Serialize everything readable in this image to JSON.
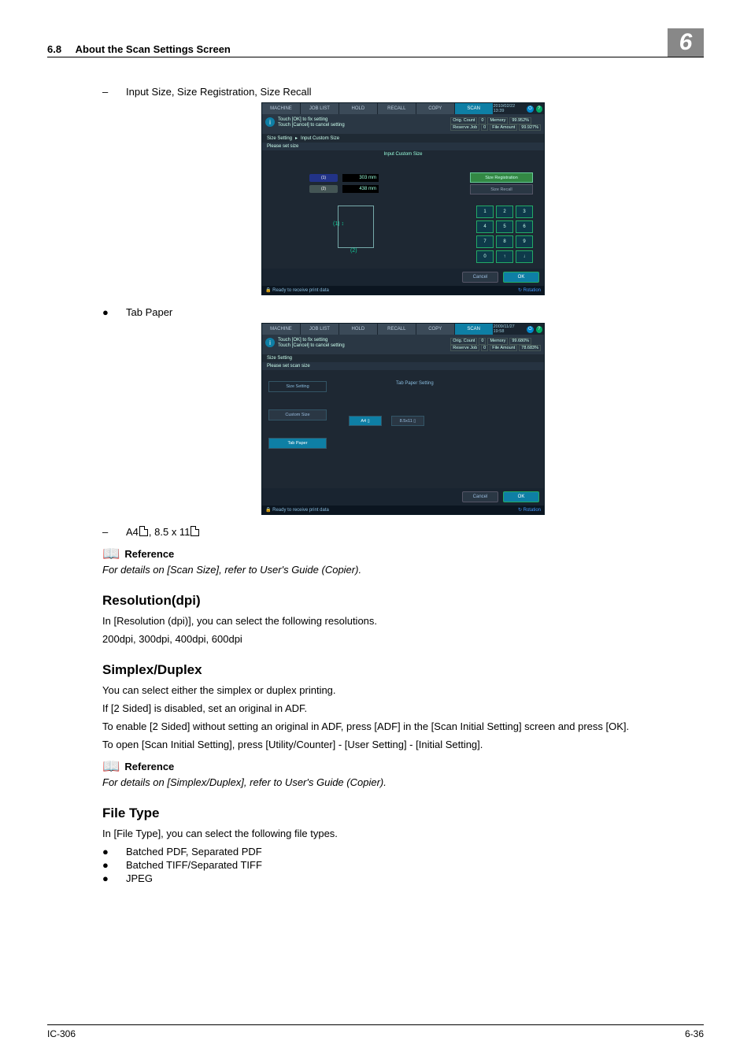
{
  "header": {
    "section_num": "6.8",
    "section_title": "About the Scan Settings Screen",
    "chapter": "6"
  },
  "top": {
    "bullet_label": "Input Size, Size Registration, Size Recall"
  },
  "shot1": {
    "tabs": [
      "MACHINE",
      "JOB LIST",
      "HOLD",
      "RECALL",
      "COPY",
      "SCAN"
    ],
    "timestamp": "2010/02/22 13:39",
    "info1": "Touch [OK] to fix setting",
    "info2": "Touch [Cancel] to cancel setting",
    "status": {
      "orig_count_label": "Orig. Count",
      "orig_count": "0",
      "reserve_label": "Reserve Job",
      "reserve": "0",
      "memory_label": "Memory",
      "memory": "99.952%",
      "file_label": "File Amount",
      "file": "99.927%"
    },
    "breadcrumb": [
      "Size Setting",
      "Input Custom Size"
    ],
    "subline": "Please set size",
    "body_title": "Input Custom Size",
    "x": {
      "label": "(1)",
      "value": "303",
      "unit": "mm"
    },
    "y": {
      "label": "(2)",
      "value": "438",
      "unit": "mm"
    },
    "fig": {
      "y": "(1)",
      "x": "(2)"
    },
    "size_reg": "Size Registration",
    "size_recall": "Size Recall",
    "keys": [
      "1",
      "2",
      "3",
      "4",
      "5",
      "6",
      "7",
      "8",
      "9",
      "0",
      "↑",
      "↓"
    ],
    "cancel": "Cancel",
    "ok": "OK",
    "statusline": "Ready to receive print data",
    "rotation": "Rotation"
  },
  "tabpaper_bullet": "Tab Paper",
  "shot2": {
    "tabs": [
      "MACHINE",
      "JOB LIST",
      "HOLD",
      "RECALL",
      "COPY",
      "SCAN"
    ],
    "timestamp": "2009/11/27 19:58",
    "info1": "Touch [OK] to fix setting",
    "info2": "Touch [Cancel] to cancel setting",
    "status": {
      "orig_count_label": "Orig. Count",
      "orig_count": "0",
      "reserve_label": "Reserve Job",
      "reserve": "0",
      "memory_label": "Memory",
      "memory": "99.680%",
      "file_label": "File Amount",
      "file": "78.683%"
    },
    "breadcrumb": "Size Setting",
    "subline": "Please set scan size",
    "left": {
      "title": "Size Setting",
      "custom": "Custom Size",
      "tab": "Tab Paper"
    },
    "right_title": "Tab Paper Setting",
    "a4": "A4 ▯",
    "g85": "8.5x11 ▯",
    "cancel": "Cancel",
    "ok": "OK",
    "statusline": "Ready to receive print data",
    "rotation": "Rotation"
  },
  "sub_bullet": "A4▯, 8.5 x 11▯",
  "reference1": {
    "title": "Reference",
    "text": "For details on [Scan Size], refer to User's Guide (Copier)."
  },
  "resolution": {
    "heading": "Resolution(dpi)",
    "p1": "In [Resolution (dpi)], you can select the following resolutions.",
    "p2": "200dpi, 300dpi, 400dpi, 600dpi"
  },
  "duplex": {
    "heading": "Simplex/Duplex",
    "p1": "You can select either the simplex or duplex printing.",
    "p2": "If [2 Sided] is disabled, set an original in ADF.",
    "p3": "To enable [2 Sided] without setting an original in ADF, press [ADF] in the [Scan Initial Setting] screen and press [OK].",
    "p4": "To open [Scan Initial Setting], press [Utility/Counter] - [User Setting] - [Initial Setting]."
  },
  "reference2": {
    "title": "Reference",
    "text": "For details on [Simplex/Duplex], refer to User's Guide (Copier)."
  },
  "filetype": {
    "heading": "File Type",
    "intro": "In [File Type], you can select the following file types.",
    "items": [
      "Batched PDF, Separated PDF",
      "Batched TIFF/Separated TIFF",
      "JPEG"
    ]
  },
  "footer": {
    "left": "IC-306",
    "right": "6-36"
  }
}
